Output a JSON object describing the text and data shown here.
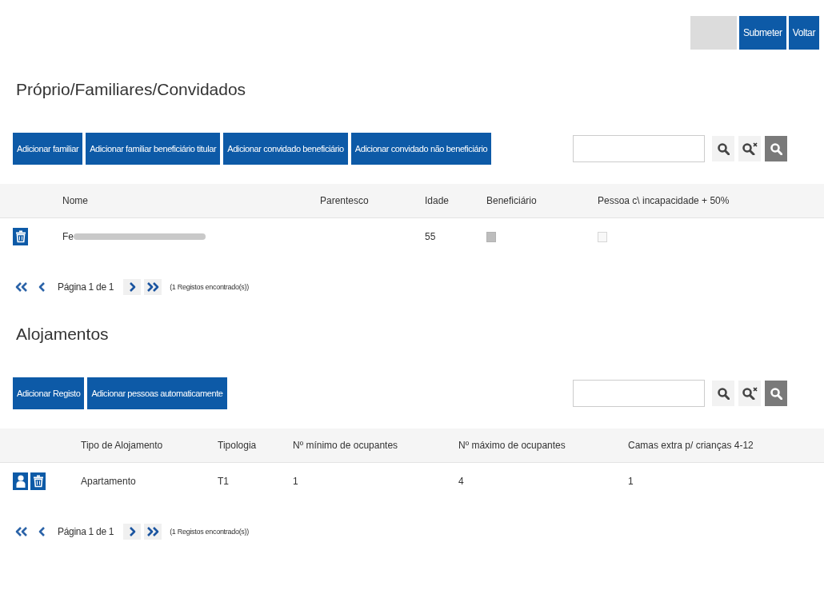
{
  "header_buttons": [
    {
      "kind": "blank",
      "disabled": true
    },
    {
      "kind": "label",
      "label": "Submeter",
      "disabled": false
    },
    {
      "kind": "label",
      "label": "Voltar",
      "disabled": false
    }
  ],
  "sections": [
    {
      "title": "Próprio/Familiares/Convidados",
      "buttons": [
        "Adicionar familiar",
        "Adicionar familiar beneficiário titular",
        "Adicionar convidado beneficiário",
        "Adicionar convidado não beneficiário"
      ],
      "table": {
        "columns": [
          "Nome",
          "Parentesco",
          "Idade",
          "Beneficiário",
          "Pessoa c\\ incapacidade + 50%"
        ],
        "rows": [
          {
            "actions": [
              {
                "kind": "delete"
              }
            ],
            "cells": [
              {
                "kind": "text",
                "text": "Fe",
                "redacted": true
              },
              {
                "kind": "empty"
              },
              {
                "kind": "text",
                "text": "55"
              },
              {
                "kind": "checkbox",
                "checked": true,
                "disabled": true
              },
              {
                "kind": "checkbox",
                "checked": false,
                "disabled": true
              }
            ]
          }
        ]
      },
      "pager": {
        "page_label": "Página 1 de 1",
        "count": "(1 Registos encontrado(s))"
      }
    },
    {
      "title": "Alojamentos",
      "buttons": [
        "Adicionar Registo",
        "Adicionar pessoas automaticamente"
      ],
      "table": {
        "columns": [
          "Tipo de Alojamento",
          "Tipologia",
          "Nº mínimo de ocupantes",
          "Nº máximo de ocupantes",
          "Camas extra p/ crianças 4-12"
        ],
        "rows": [
          {
            "actions": [
              {
                "kind": "user"
              },
              {
                "kind": "delete"
              }
            ],
            "cells": [
              {
                "kind": "text",
                "text": "Apartamento"
              },
              {
                "kind": "text",
                "text": "T1"
              },
              {
                "kind": "text",
                "text": "1"
              },
              {
                "kind": "text",
                "text": "4"
              },
              {
                "kind": "text",
                "text": "1"
              }
            ]
          }
        ]
      },
      "pager": {
        "page_label": "Página 1 de 1",
        "count": "(1 Registos encontrado(s))"
      }
    }
  ]
}
